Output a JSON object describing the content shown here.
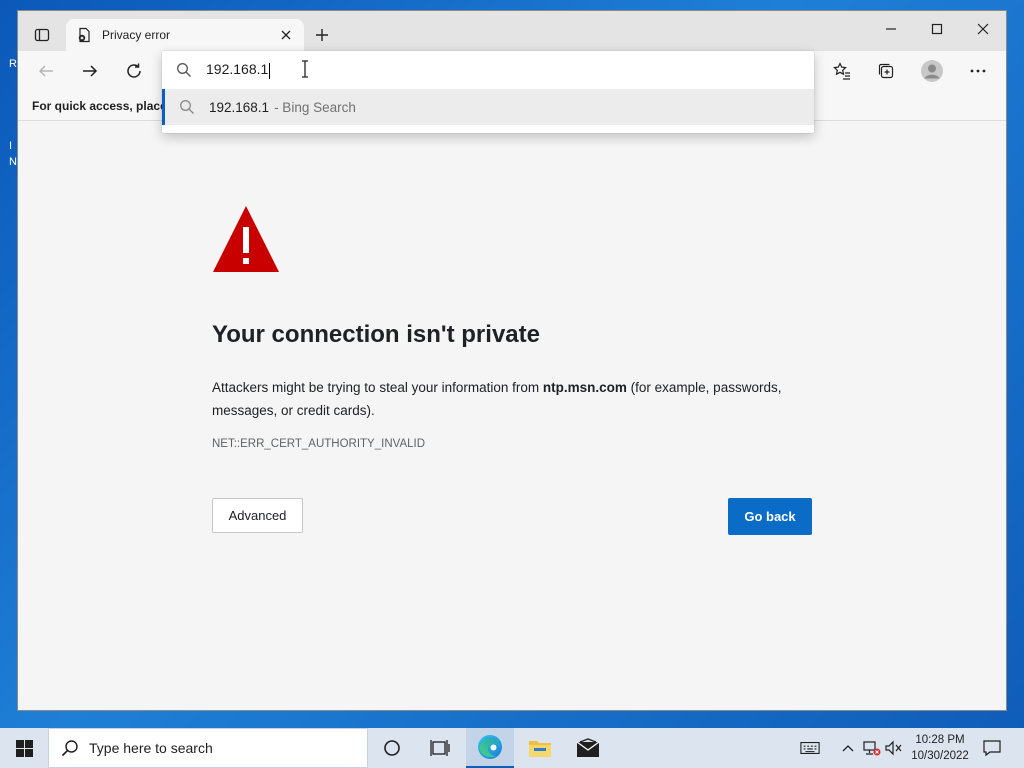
{
  "browser": {
    "tab_title": "Privacy error",
    "favorites_hint": "For quick access, place your favorites here on the favorites bar.",
    "address_value": "192.168.1",
    "suggestion_main": "192.168.1",
    "suggestion_sub": "- Bing Search"
  },
  "page": {
    "title": "Your connection isn't private",
    "desc_before": "Attackers might be trying to steal your information from ",
    "desc_domain": "ntp.msn.com",
    "desc_after": " (for example, passwords, messages, or credit cards).",
    "error_code": "NET::ERR_CERT_AUTHORITY_INVALID",
    "advanced_label": "Advanced",
    "goback_label": "Go back"
  },
  "taskbar": {
    "search_placeholder": "Type here to search",
    "time": "10:28 PM",
    "date": "10/30/2022"
  },
  "desktop": {
    "edge_glyphs": [
      "R",
      "I",
      "N"
    ]
  },
  "colors": {
    "accent": "#0a6cc7",
    "warning": "#c90000"
  }
}
